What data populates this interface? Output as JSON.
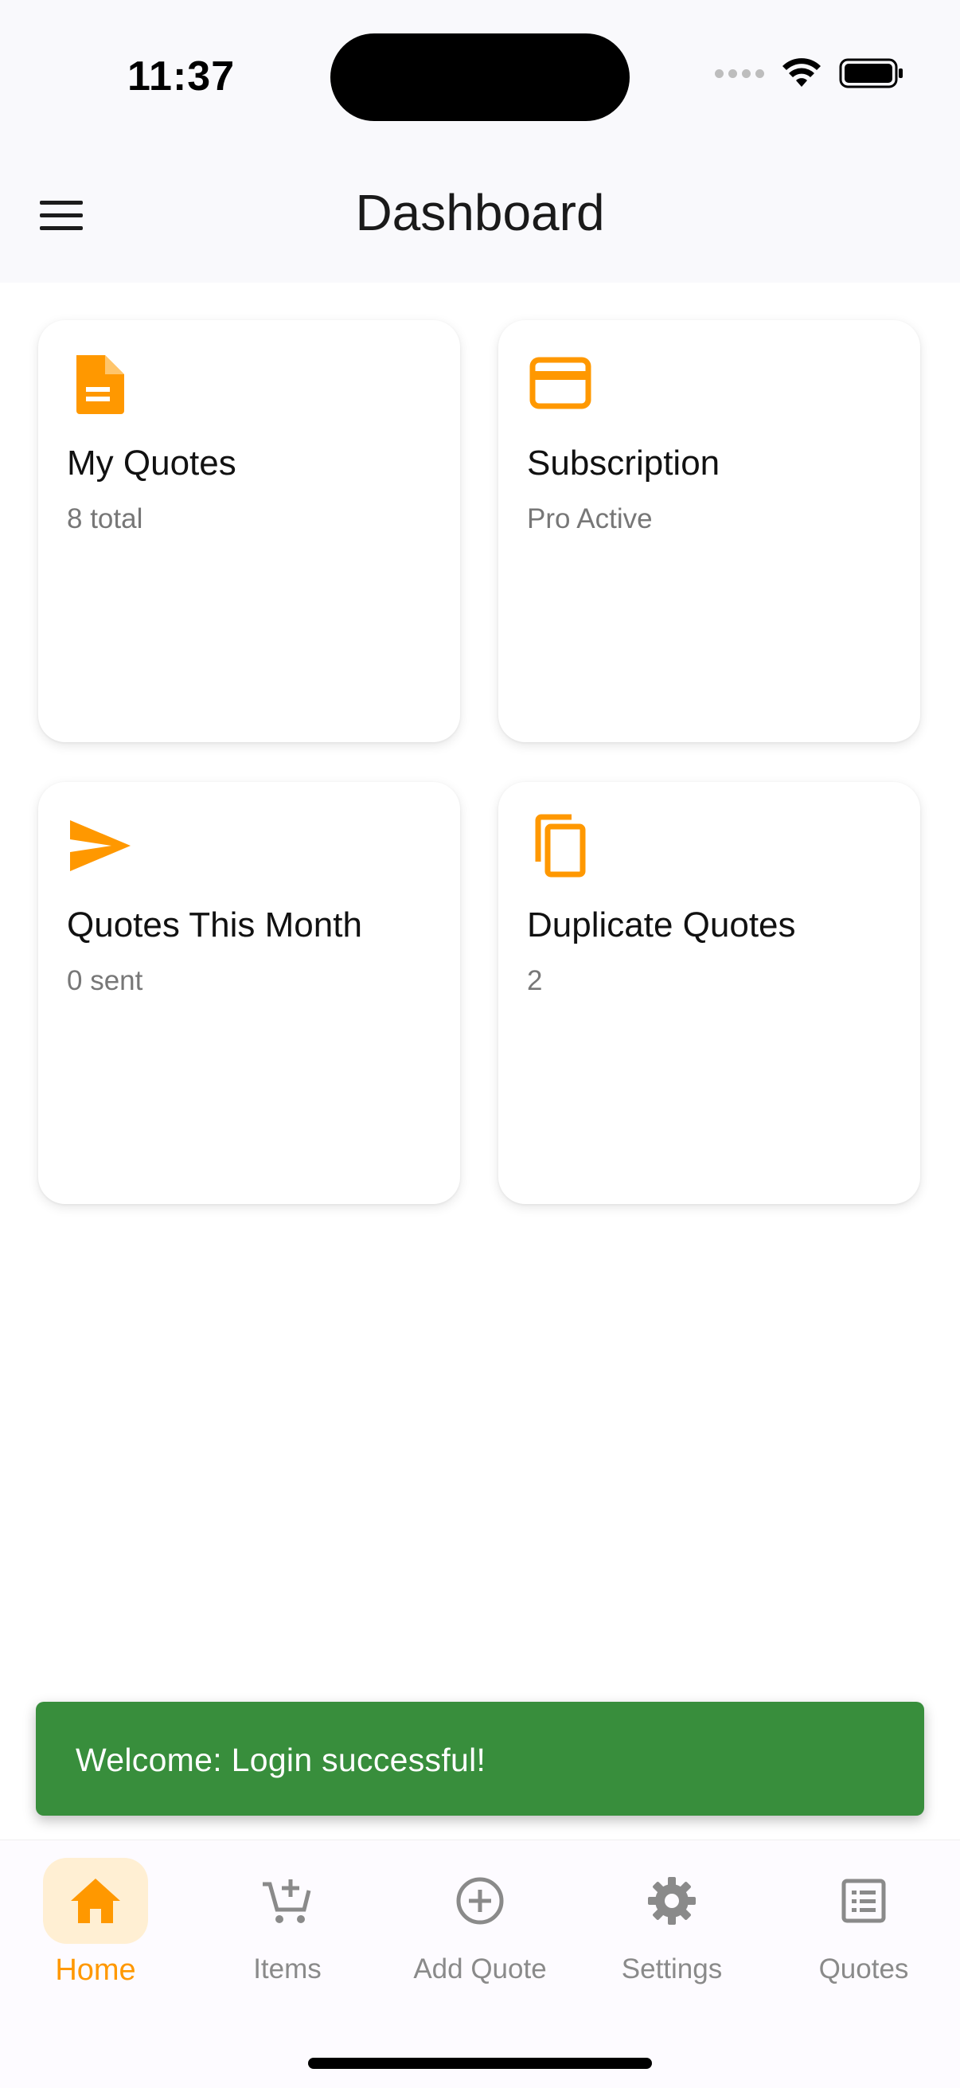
{
  "status_bar": {
    "time": "11:37"
  },
  "app_bar": {
    "title": "Dashboard"
  },
  "cards": [
    {
      "title": "My Quotes",
      "subtitle": "8 total",
      "icon": "document-icon"
    },
    {
      "title": "Subscription",
      "subtitle": "Pro Active",
      "icon": "credit-card-icon"
    },
    {
      "title": "Quotes This Month",
      "subtitle": "0 sent",
      "icon": "send-icon"
    },
    {
      "title": "Duplicate Quotes",
      "subtitle": "2",
      "icon": "copy-icon"
    }
  ],
  "snackbar": {
    "message": "Welcome: Login successful!"
  },
  "bottom_nav": {
    "items": [
      {
        "label": "Home",
        "icon": "home-icon",
        "active": true
      },
      {
        "label": "Items",
        "icon": "add-cart-icon",
        "active": false
      },
      {
        "label": "Add Quote",
        "icon": "add-circle-icon",
        "active": false
      },
      {
        "label": "Settings",
        "icon": "gear-icon",
        "active": false
      },
      {
        "label": "Quotes",
        "icon": "list-icon",
        "active": false
      }
    ]
  },
  "colors": {
    "accent": "#ff9800",
    "accent_light": "#ffefd3",
    "snackbar": "#388e3c",
    "inactive": "#8a8a8a"
  }
}
